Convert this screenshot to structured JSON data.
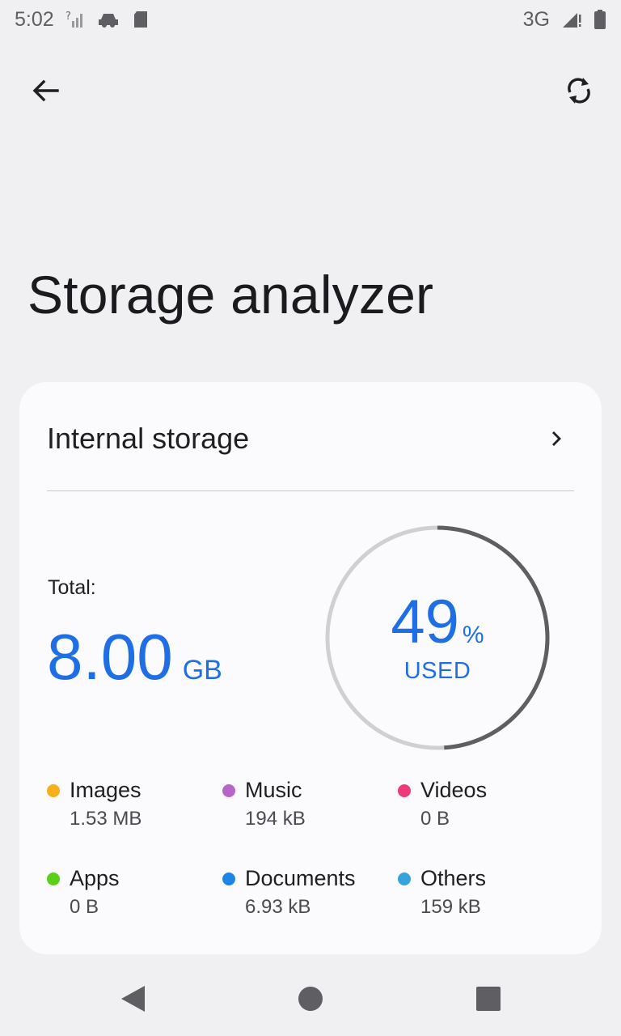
{
  "status_bar": {
    "time": "5:02",
    "network": "3G",
    "icons": [
      "signal-question-icon",
      "car-icon",
      "sd-card-icon",
      "signal-icon",
      "battery-icon"
    ]
  },
  "app_bar": {
    "back_icon": "arrow-left-icon",
    "refresh_icon": "refresh-icon"
  },
  "page": {
    "title": "Storage analyzer"
  },
  "storage_card": {
    "title": "Internal storage",
    "total_label": "Total:",
    "total_value": "8.00",
    "total_unit": "GB",
    "used_percent": "49",
    "used_percent_symbol": "%",
    "used_label": "USED",
    "used_fraction": 0.49,
    "legend": [
      {
        "name": "Images",
        "size": "1.53 MB",
        "color": "#f5b01a"
      },
      {
        "name": "Music",
        "size": "194 kB",
        "color": "#b765c9"
      },
      {
        "name": "Videos",
        "size": "0 B",
        "color": "#ef3a78"
      },
      {
        "name": "Apps",
        "size": "0 B",
        "color": "#5bd018"
      },
      {
        "name": "Documents",
        "size": "6.93 kB",
        "color": "#1f84e8"
      },
      {
        "name": "Others",
        "size": "159 kB",
        "color": "#35a4dc"
      }
    ]
  },
  "colors": {
    "accent": "#1e6fe6",
    "gauge_track": "#d0d0d3",
    "gauge_fill": "#5f5f62"
  },
  "nav_bar": {
    "icons": [
      "back-triangle-icon",
      "home-circle-icon",
      "recents-square-icon"
    ]
  }
}
